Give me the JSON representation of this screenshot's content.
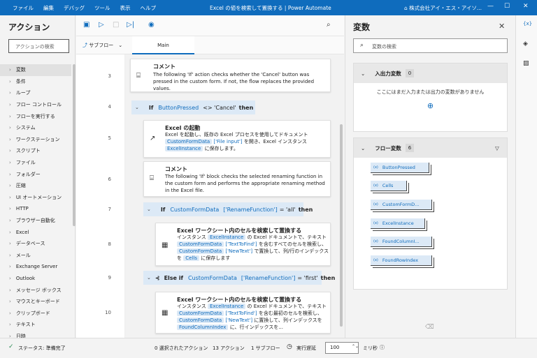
{
  "menu": [
    "ファイル",
    "編集",
    "デバッグ",
    "ツール",
    "表示",
    "ヘルプ"
  ],
  "window_title": "Excel の値を検索して置換する | Power Automate",
  "account": "株式会社アイ・エス・アイソ...",
  "actions_panel": {
    "title": "アクション",
    "search_placeholder": "アクションの検索",
    "categories": [
      "変数",
      "条件",
      "ループ",
      "フロー コントロール",
      "フローを実行する",
      "システム",
      "ワークステーション",
      "スクリプト",
      "ファイル",
      "フォルダー",
      "圧縮",
      "UI オートメーション",
      "HTTP",
      "ブラウザー自動化",
      "Excel",
      "データベース",
      "メール",
      "Exchange Server",
      "Outlook",
      "メッセージ ボックス",
      "マウスとキーボード",
      "クリップボード",
      "テキスト",
      "日時"
    ]
  },
  "designer": {
    "subflow_label": "サブフロー",
    "tab_main": "Main",
    "steps": [
      {
        "line": "3",
        "title": "コメント",
        "text": "The following 'If' action checks whether the 'Cancel' button was pressed in the custom form. If not, the flow replaces the provided values."
      },
      {
        "line": "4",
        "kw": "If",
        "var": "ButtonPressed",
        "op": "<> 'Cancel'",
        "then": "then"
      },
      {
        "line": "5",
        "title": "Excel の起動",
        "t1": "Excel を起動し、既存の Excel プロセスを使用してドキュメント",
        "v1": "CustomFormData",
        "v1b": "['File input']",
        "t2": "を開き、Excel インスタンス",
        "v2": "ExcelInstance",
        "t3": "に保存します。"
      },
      {
        "line": "6",
        "title": "コメント",
        "text": "The following 'If' block checks the selected renaming function in the custom form and performs the appropriate renaming method in the Excel file."
      },
      {
        "line": "7",
        "kw": "If",
        "var": "CustomFormData",
        "idx": "['RenameFunction']",
        "op": "= 'all'",
        "then": "then"
      },
      {
        "line": "8",
        "title": "Excel ワークシート内のセルを検索して置換する",
        "a": "インスタンス",
        "b": "ExcelInstance",
        "c": "の Excel ドキュメントで、テキスト",
        "d": "CustomFormData",
        "e": "['TextToFind']",
        "f": "を含むすべてのセルを検索し、",
        "g": "CustomFormData",
        "h": "['NewText']",
        "i": "で置換して、列/行のインデックスを",
        "j": "Cells",
        "k": "に保存します"
      },
      {
        "line": "9",
        "kw": "Else if",
        "var": "CustomFormData",
        "idx": "['RenameFunction']",
        "op": "= 'first'",
        "then": "then"
      },
      {
        "line": "10",
        "title": "Excel ワークシート内のセルを検索して置換する",
        "a": "インスタンス",
        "b": "ExcelInstance",
        "c": "の Excel ドキュメントで、テキスト",
        "d": "CustomFormData",
        "e": "['TextToFind']",
        "f": "を含む最初のセルを検索し、",
        "g": "CustomFormData",
        "h": "['NewText']",
        "i": "に置換して、列インデックスを",
        "j": "FoundColumnIndex",
        "k": "に、行インデックスを..."
      }
    ]
  },
  "variables_panel": {
    "title": "変数",
    "search_placeholder": "変数の検索",
    "io_label": "入出力変数",
    "io_count": "0",
    "io_empty": "ここにはまだ入力または出力の変数がありません",
    "flow_label": "フロー変数",
    "flow_count": "6",
    "flow_vars": [
      "ButtonPressed",
      "Cells",
      "CustomFormD...",
      "ExcelInstance",
      "FoundColumnI...",
      "FoundRowIndex"
    ]
  },
  "status": {
    "state": "ステータス: 準備完了",
    "selected": "0 選択されたアクション",
    "actions": "13 アクション",
    "subflows": "1 サブフロー",
    "delay_label": "実行遅延",
    "delay_value": "100",
    "unit": "ミリ秒"
  }
}
